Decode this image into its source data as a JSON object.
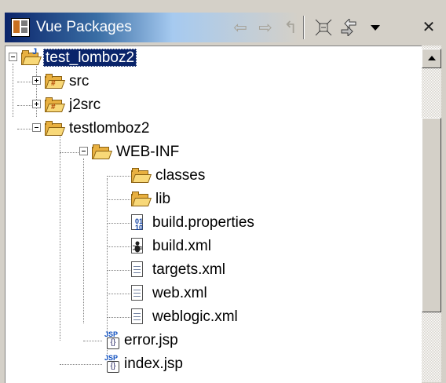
{
  "view": {
    "title": "Vue Packages",
    "toolbar": {
      "back_icon": "back-arrow-icon",
      "forward_icon": "forward-arrow-icon",
      "up_icon": "up-arrow-icon",
      "collapse_icon": "collapse-all-icon",
      "link_icon": "link-with-editor-icon",
      "menu_icon": "view-menu-down-icon",
      "close_glyph": "✕"
    }
  },
  "tree": {
    "items": [
      {
        "label": "test_lomboz2",
        "selected": true
      },
      {
        "label": "src"
      },
      {
        "label": "j2src"
      },
      {
        "label": "testlomboz2"
      },
      {
        "label": "WEB-INF"
      },
      {
        "label": "classes"
      },
      {
        "label": "lib"
      },
      {
        "label": "build.properties"
      },
      {
        "label": "build.xml"
      },
      {
        "label": "targets.xml"
      },
      {
        "label": "web.xml"
      },
      {
        "label": "weblogic.xml"
      },
      {
        "label": "error.jsp"
      },
      {
        "label": "index.jsp"
      }
    ]
  },
  "colors": {
    "title_active_start": "#0a246a",
    "title_active_end": "#a6caf0",
    "selection": "#0a246a",
    "window_face": "#d4d0c8"
  }
}
